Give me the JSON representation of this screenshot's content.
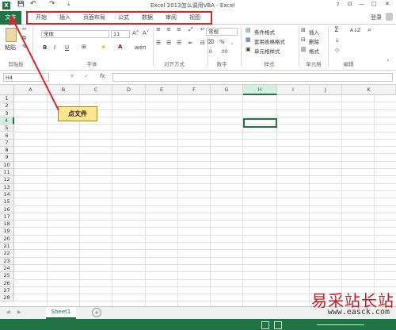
{
  "titlebar": {
    "title": "Excel 2013怎么调用VBA - Excel",
    "help": "?",
    "ribbon_opts": "⊡",
    "min": "—",
    "max": "□",
    "close": "✕",
    "login": "登录"
  },
  "quick_access": {
    "save": "💾",
    "undo": "↶",
    "redo": "↷",
    "customize": "⇣"
  },
  "tabs": {
    "file": "文件",
    "items": [
      "开始",
      "插入",
      "页面布局",
      "公式",
      "数据",
      "审阅",
      "视图"
    ]
  },
  "ribbon": {
    "clipboard": {
      "label": "剪贴板",
      "paste": "粘贴"
    },
    "font": {
      "label": "字体",
      "name": "宋体",
      "size": "11",
      "grow": "A˄",
      "shrink": "A˅",
      "bold": "B",
      "italic": "I",
      "underline": "U",
      "wen": "wén"
    },
    "align": {
      "label": "对齐方式"
    },
    "number": {
      "label": "数字",
      "format": "常规",
      "percent": "%",
      "comma": ",",
      "inc_dec": ".0",
      "dec_dec": ".00"
    },
    "styles": {
      "label": "样式",
      "cond": "条件格式",
      "table": "套用表格格式",
      "cell": "单元格样式"
    },
    "cells": {
      "label": "单元格",
      "insert": "插入",
      "delete": "删除",
      "format": "格式"
    },
    "editing": {
      "label": "编辑",
      "sum": "Σ",
      "fill": "↓",
      "clear": "◇",
      "sort": "A↓Z",
      "find": "⌕"
    }
  },
  "formula_bar": {
    "namebox": "H4",
    "cancel": "✕",
    "enter": "✓",
    "fx": "fx",
    "value": ""
  },
  "columns": [
    "A",
    "B",
    "C",
    "D",
    "E",
    "F",
    "G",
    "H",
    "I",
    "J",
    "K"
  ],
  "rows": [
    "1",
    "2",
    "3",
    "4",
    "5",
    "6",
    "7",
    "8",
    "9",
    "10",
    "11",
    "12",
    "13",
    "14",
    "15",
    "16",
    "17",
    "18",
    "19",
    "20",
    "21",
    "22",
    "23",
    "24",
    "25",
    "26",
    "27",
    "28"
  ],
  "sheets": {
    "active": "Sheet1",
    "add": "+",
    "nav_prev": "◀",
    "nav_next": "▶"
  },
  "callout": "点文件",
  "watermark": {
    "cn": "易采站长站",
    "url": "www.easck.com"
  },
  "colors": {
    "accent": "#217346",
    "callout_border": "#d9262b",
    "callout_bg": "#ffe58f"
  }
}
